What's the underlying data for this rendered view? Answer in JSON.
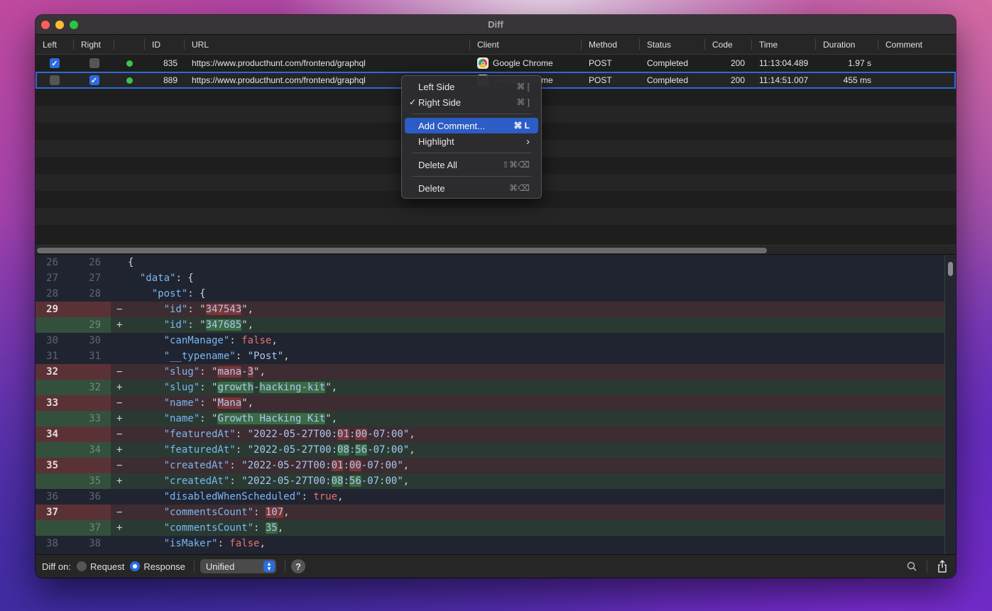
{
  "window": {
    "title": "Diff"
  },
  "table": {
    "columns": [
      "Left",
      "Right",
      "",
      "ID",
      "URL",
      "Client",
      "Method",
      "Status",
      "Code",
      "Time",
      "Duration",
      "Comment"
    ],
    "rows": [
      {
        "left_checked": true,
        "right_checked": false,
        "status_color": "#3fc34d",
        "id": "835",
        "url": "https://www.producthunt.com/frontend/graphql",
        "client": "Google Chrome",
        "method": "POST",
        "status": "Completed",
        "code": "200",
        "time": "11:13:04.489",
        "duration": "1.97 s",
        "comment": ""
      },
      {
        "left_checked": false,
        "right_checked": true,
        "status_color": "#3fc34d",
        "id": "889",
        "url": "https://www.producthunt.com/frontend/graphql",
        "client": "Google Chrome",
        "method": "POST",
        "status": "Completed",
        "code": "200",
        "time": "11:14:51.007",
        "duration": "455 ms",
        "comment": "",
        "selected": true
      }
    ]
  },
  "context_menu": {
    "items": [
      {
        "label": "Left Side",
        "shortcut": "⌘ [",
        "checked": false
      },
      {
        "label": "Right Side",
        "shortcut": "⌘ ]",
        "checked": true
      },
      {
        "label": "Add Comment...",
        "shortcut": "⌘ L",
        "highlighted": true
      },
      {
        "label": "Highlight",
        "shortcut": "›",
        "submenu": true
      },
      {
        "label": "Delete All",
        "shortcut": "⇧⌘⌫"
      },
      {
        "label": "Delete",
        "shortcut": "⌘⌫"
      }
    ]
  },
  "diff": {
    "lines": [
      {
        "type": "ctx",
        "l": "26",
        "r": "26",
        "sign": "",
        "indent": "",
        "parts": [
          [
            "s",
            "{"
          ]
        ]
      },
      {
        "type": "ctx",
        "l": "27",
        "r": "27",
        "sign": "",
        "indent": "  ",
        "parts": [
          [
            "k",
            "\"data\""
          ],
          [
            "s",
            ": {"
          ]
        ]
      },
      {
        "type": "ctx",
        "l": "28",
        "r": "28",
        "sign": "",
        "indent": "    ",
        "parts": [
          [
            "k",
            "\"post\""
          ],
          [
            "s",
            ": {"
          ]
        ]
      },
      {
        "type": "del",
        "l": "29",
        "r": "",
        "sign": "−",
        "indent": "      ",
        "parts": [
          [
            "k",
            "\"id\""
          ],
          [
            "s",
            ": \""
          ],
          [
            "hd",
            "347543"
          ],
          [
            "s",
            "\","
          ]
        ]
      },
      {
        "type": "add",
        "l": "",
        "r": "29",
        "sign": "+",
        "indent": "      ",
        "parts": [
          [
            "k",
            "\"id\""
          ],
          [
            "s",
            ": \""
          ],
          [
            "ha",
            "347685"
          ],
          [
            "s",
            "\","
          ]
        ]
      },
      {
        "type": "ctx",
        "l": "30",
        "r": "30",
        "sign": "",
        "indent": "      ",
        "parts": [
          [
            "k",
            "\"canManage\""
          ],
          [
            "s",
            ": "
          ],
          [
            "b",
            "false"
          ],
          [
            "s",
            ","
          ]
        ]
      },
      {
        "type": "ctx",
        "l": "31",
        "r": "31",
        "sign": "",
        "indent": "      ",
        "parts": [
          [
            "k",
            "\"__typename\""
          ],
          [
            "s",
            ": "
          ],
          [
            "sv",
            "\"Post\""
          ],
          [
            "s",
            ","
          ]
        ]
      },
      {
        "type": "del",
        "l": "32",
        "r": "",
        "sign": "−",
        "indent": "      ",
        "parts": [
          [
            "k",
            "\"slug\""
          ],
          [
            "s",
            ": \""
          ],
          [
            "hd",
            "mana"
          ],
          [
            "sv",
            "-"
          ],
          [
            "hd",
            "3"
          ],
          [
            "s",
            "\","
          ]
        ]
      },
      {
        "type": "add",
        "l": "",
        "r": "32",
        "sign": "+",
        "indent": "      ",
        "parts": [
          [
            "k",
            "\"slug\""
          ],
          [
            "s",
            ": \""
          ],
          [
            "ha",
            "growth"
          ],
          [
            "sv",
            "-"
          ],
          [
            "ha",
            "hacking-kit"
          ],
          [
            "s",
            "\","
          ]
        ]
      },
      {
        "type": "del",
        "l": "33",
        "r": "",
        "sign": "−",
        "indent": "      ",
        "parts": [
          [
            "k",
            "\"name\""
          ],
          [
            "s",
            ": \""
          ],
          [
            "hd",
            "Mana"
          ],
          [
            "s",
            "\","
          ]
        ]
      },
      {
        "type": "add",
        "l": "",
        "r": "33",
        "sign": "+",
        "indent": "      ",
        "parts": [
          [
            "k",
            "\"name\""
          ],
          [
            "s",
            ": \""
          ],
          [
            "ha",
            "Growth Hacking Kit"
          ],
          [
            "s",
            "\","
          ]
        ]
      },
      {
        "type": "del",
        "l": "34",
        "r": "",
        "sign": "−",
        "indent": "      ",
        "parts": [
          [
            "k",
            "\"featuredAt\""
          ],
          [
            "s",
            ": "
          ],
          [
            "sv",
            "\"2022-05-27T00:"
          ],
          [
            "hd",
            "01"
          ],
          [
            "sv",
            ":"
          ],
          [
            "hd",
            "00"
          ],
          [
            "sv",
            "-07:00\""
          ],
          [
            "s",
            ","
          ]
        ]
      },
      {
        "type": "add",
        "l": "",
        "r": "34",
        "sign": "+",
        "indent": "      ",
        "parts": [
          [
            "k",
            "\"featuredAt\""
          ],
          [
            "s",
            ": "
          ],
          [
            "sv",
            "\"2022-05-27T00:"
          ],
          [
            "ha",
            "08"
          ],
          [
            "sv",
            ":"
          ],
          [
            "ha",
            "56"
          ],
          [
            "sv",
            "-07:00\""
          ],
          [
            "s",
            ","
          ]
        ]
      },
      {
        "type": "del",
        "l": "35",
        "r": "",
        "sign": "−",
        "indent": "      ",
        "parts": [
          [
            "k",
            "\"createdAt\""
          ],
          [
            "s",
            ": "
          ],
          [
            "sv",
            "\"2022-05-27T00:"
          ],
          [
            "hd",
            "01"
          ],
          [
            "sv",
            ":"
          ],
          [
            "hd",
            "00"
          ],
          [
            "sv",
            "-07:00\""
          ],
          [
            "s",
            ","
          ]
        ]
      },
      {
        "type": "add",
        "l": "",
        "r": "35",
        "sign": "+",
        "indent": "      ",
        "parts": [
          [
            "k",
            "\"createdAt\""
          ],
          [
            "s",
            ": "
          ],
          [
            "sv",
            "\"2022-05-27T00:"
          ],
          [
            "ha",
            "08"
          ],
          [
            "sv",
            ":"
          ],
          [
            "ha",
            "56"
          ],
          [
            "sv",
            "-07:00\""
          ],
          [
            "s",
            ","
          ]
        ]
      },
      {
        "type": "ctx",
        "l": "36",
        "r": "36",
        "sign": "",
        "indent": "      ",
        "parts": [
          [
            "k",
            "\"disabledWhenScheduled\""
          ],
          [
            "s",
            ": "
          ],
          [
            "b",
            "true"
          ],
          [
            "s",
            ","
          ]
        ]
      },
      {
        "type": "del",
        "l": "37",
        "r": "",
        "sign": "−",
        "indent": "      ",
        "parts": [
          [
            "k",
            "\"commentsCount\""
          ],
          [
            "s",
            ": "
          ],
          [
            "hd",
            "107"
          ],
          [
            "s",
            ","
          ]
        ]
      },
      {
        "type": "add",
        "l": "",
        "r": "37",
        "sign": "+",
        "indent": "      ",
        "parts": [
          [
            "k",
            "\"commentsCount\""
          ],
          [
            "s",
            ": "
          ],
          [
            "ha",
            "35"
          ],
          [
            "s",
            ","
          ]
        ]
      },
      {
        "type": "ctx",
        "l": "38",
        "r": "38",
        "sign": "",
        "indent": "      ",
        "parts": [
          [
            "k",
            "\"isMaker\""
          ],
          [
            "s",
            ": "
          ],
          [
            "b",
            "false"
          ],
          [
            "s",
            ","
          ]
        ]
      }
    ]
  },
  "footer": {
    "diff_on_label": "Diff on:",
    "request_label": "Request",
    "response_label": "Response",
    "selected_target": "Response",
    "mode_value": "Unified",
    "help_label": "?"
  },
  "colors": {
    "accent": "#2a6ce0",
    "selection_outline": "#2a6bd6",
    "status_ok": "#3fc34d",
    "menu_highlight": "#2c5cc5"
  }
}
